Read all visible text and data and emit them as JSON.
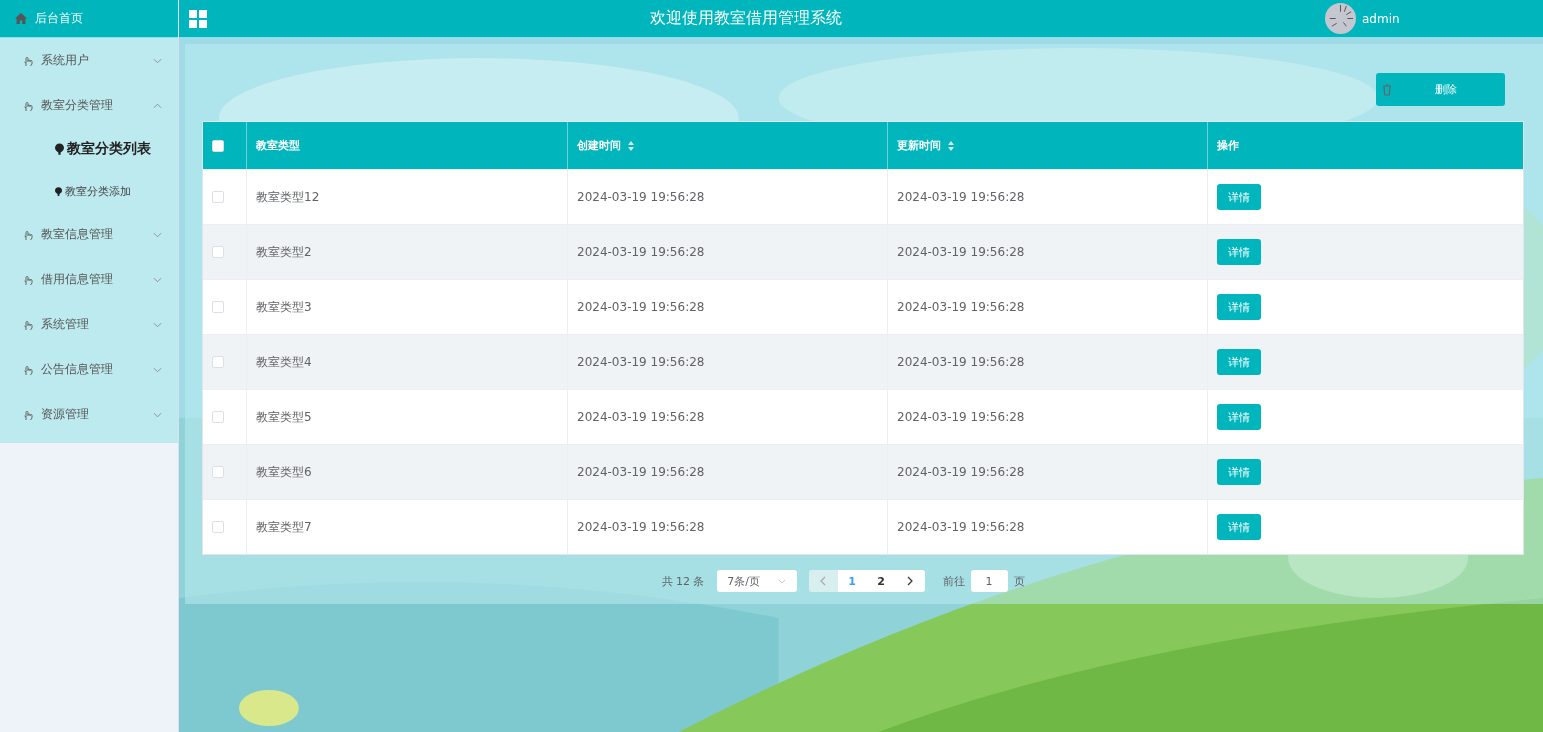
{
  "sidebar": {
    "home": "后台首页",
    "menu": [
      {
        "label": "系统用户",
        "expanded": false
      },
      {
        "label": "教室分类管理",
        "expanded": true,
        "children": [
          {
            "label": "教室分类列表",
            "selected": true
          },
          {
            "label": "教室分类添加",
            "selected": false
          }
        ]
      },
      {
        "label": "教室信息管理",
        "expanded": false
      },
      {
        "label": "借用信息管理",
        "expanded": false
      },
      {
        "label": "系统管理",
        "expanded": false
      },
      {
        "label": "公告信息管理",
        "expanded": false
      },
      {
        "label": "资源管理",
        "expanded": false
      }
    ]
  },
  "header": {
    "title": "欢迎使用教室借用管理系统",
    "user": "admin"
  },
  "toolbar": {
    "delete_button": "删除"
  },
  "table": {
    "all_checked": false,
    "columns": [
      {
        "label": "教室类型",
        "kind": "plain"
      },
      {
        "label": "创建时间",
        "kind": "sortable"
      },
      {
        "label": "更新时间",
        "kind": "sortable"
      },
      {
        "label": "操作",
        "kind": "plain"
      }
    ],
    "rows": [
      {
        "checked": false,
        "type": "教室类型12",
        "created": "2024-03-19 19:56:28",
        "updated": "2024-03-19 19:56:28",
        "action": "详情"
      },
      {
        "checked": false,
        "type": "教室类型2",
        "created": "2024-03-19 19:56:28",
        "updated": "2024-03-19 19:56:28",
        "action": "详情"
      },
      {
        "checked": false,
        "type": "教室类型3",
        "created": "2024-03-19 19:56:28",
        "updated": "2024-03-19 19:56:28",
        "action": "详情"
      },
      {
        "checked": false,
        "type": "教室类型4",
        "created": "2024-03-19 19:56:28",
        "updated": "2024-03-19 19:56:28",
        "action": "详情"
      },
      {
        "checked": false,
        "type": "教室类型5",
        "created": "2024-03-19 19:56:28",
        "updated": "2024-03-19 19:56:28",
        "action": "详情"
      },
      {
        "checked": false,
        "type": "教室类型6",
        "created": "2024-03-19 19:56:28",
        "updated": "2024-03-19 19:56:28",
        "action": "详情"
      },
      {
        "checked": false,
        "type": "教室类型7",
        "created": "2024-03-19 19:56:28",
        "updated": "2024-03-19 19:56:28",
        "action": "详情"
      }
    ]
  },
  "pagination": {
    "total": "共 12 条",
    "page_size": "7条/页",
    "pages": [
      {
        "label": "1",
        "selected": true
      },
      {
        "label": "2",
        "selected": false
      }
    ],
    "goto_label": "前往",
    "goto_value": "1",
    "goto_suffix": "页"
  }
}
